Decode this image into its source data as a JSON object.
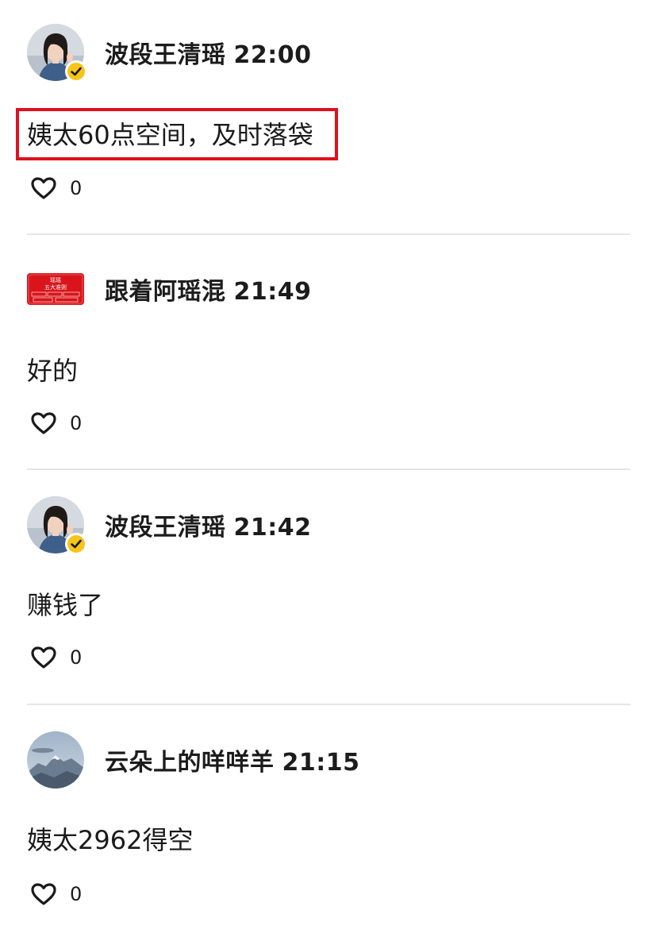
{
  "comments": [
    {
      "username": "波段王清瑶",
      "time": "22:00",
      "avatar": "woman-portrait-avatar",
      "verified": true,
      "text": "姨太60点空间，及时落袋",
      "highlighted": true,
      "likes": "0"
    },
    {
      "username": "跟着阿瑶混",
      "time": "21:49",
      "avatar": "red-banner-avatar",
      "avatar_text": {
        "line1": "瑶瑶",
        "line2": "五大准则"
      },
      "verified": false,
      "text": "好的",
      "highlighted": false,
      "likes": "0"
    },
    {
      "username": "波段王清瑶",
      "time": "21:42",
      "avatar": "woman-portrait-avatar",
      "verified": true,
      "text": "赚钱了",
      "highlighted": false,
      "likes": "0"
    },
    {
      "username": "云朵上的咩咩羊",
      "time": "21:15",
      "avatar": "mountain-landscape-avatar",
      "verified": false,
      "text": "姨太2962得空",
      "highlighted": false,
      "likes": "0"
    }
  ],
  "colors": {
    "highlight_border": "#e01020",
    "verified_badge": "#f5c518",
    "divider": "#e6e6e6",
    "red_banner": "#d9151b"
  },
  "icons": {
    "like": "heart-outline-icon",
    "verified": "verified-check-icon"
  }
}
